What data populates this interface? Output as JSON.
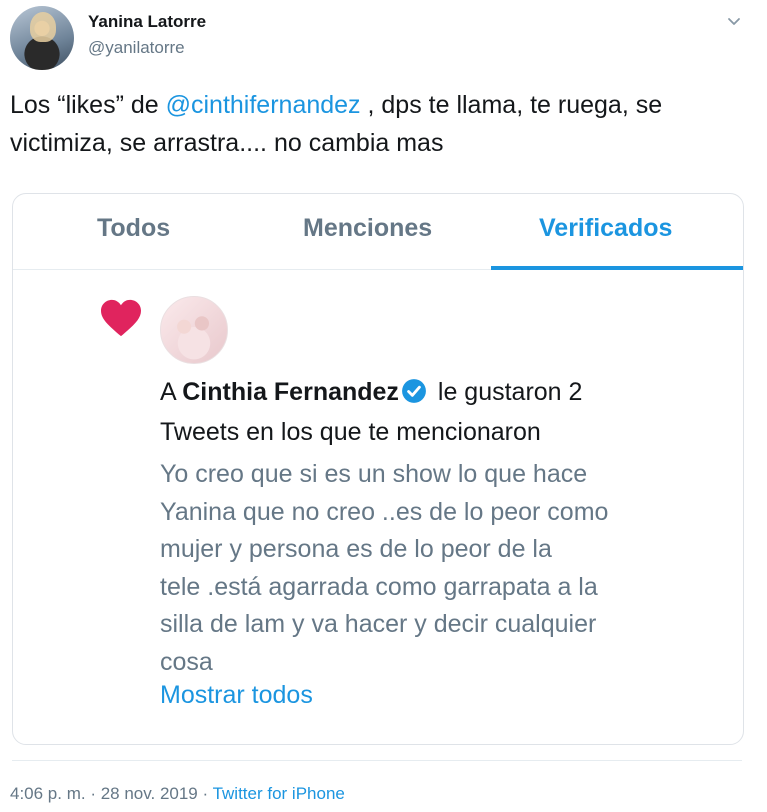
{
  "author": {
    "name": "Yanina Latorre",
    "handle": "@yanilatorre"
  },
  "tweet": {
    "text_before": "Los “likes” de ",
    "mention": "@cinthifernandez",
    "text_after": " , dps te llama, te ruega, se victimiza, se arrastra.... no cambia mas"
  },
  "card": {
    "tabs": [
      "Todos",
      "Menciones",
      "Verificados"
    ],
    "active_tab": "Verificados",
    "prefix": "A ",
    "liker_name": "Cinthia Fernandez",
    "line1_suffix": " le gustaron 2",
    "line2": "Tweets en los que te mencionaron",
    "quoted_text": "Yo creo que si es un show lo que hace\nYanina que no creo ..es de lo peor  como\nmujer y persona es de lo peor de la\ntele .está agarrada como garrapata a la\nsilla de lam y va hacer y decir cualquier\ncosa",
    "show_all": "Mostrar todos"
  },
  "footer": {
    "time": "4:06 p. m.",
    "separator": " · ",
    "date": "28 nov. 2019",
    "source": "Twitter for iPhone"
  },
  "icons": {
    "heart": "heart-icon",
    "verified": "verified-badge-icon",
    "chevron": "chevron-down-icon"
  },
  "colors": {
    "accent": "#1b95e0",
    "heart": "#e0245e",
    "muted": "#657786"
  }
}
